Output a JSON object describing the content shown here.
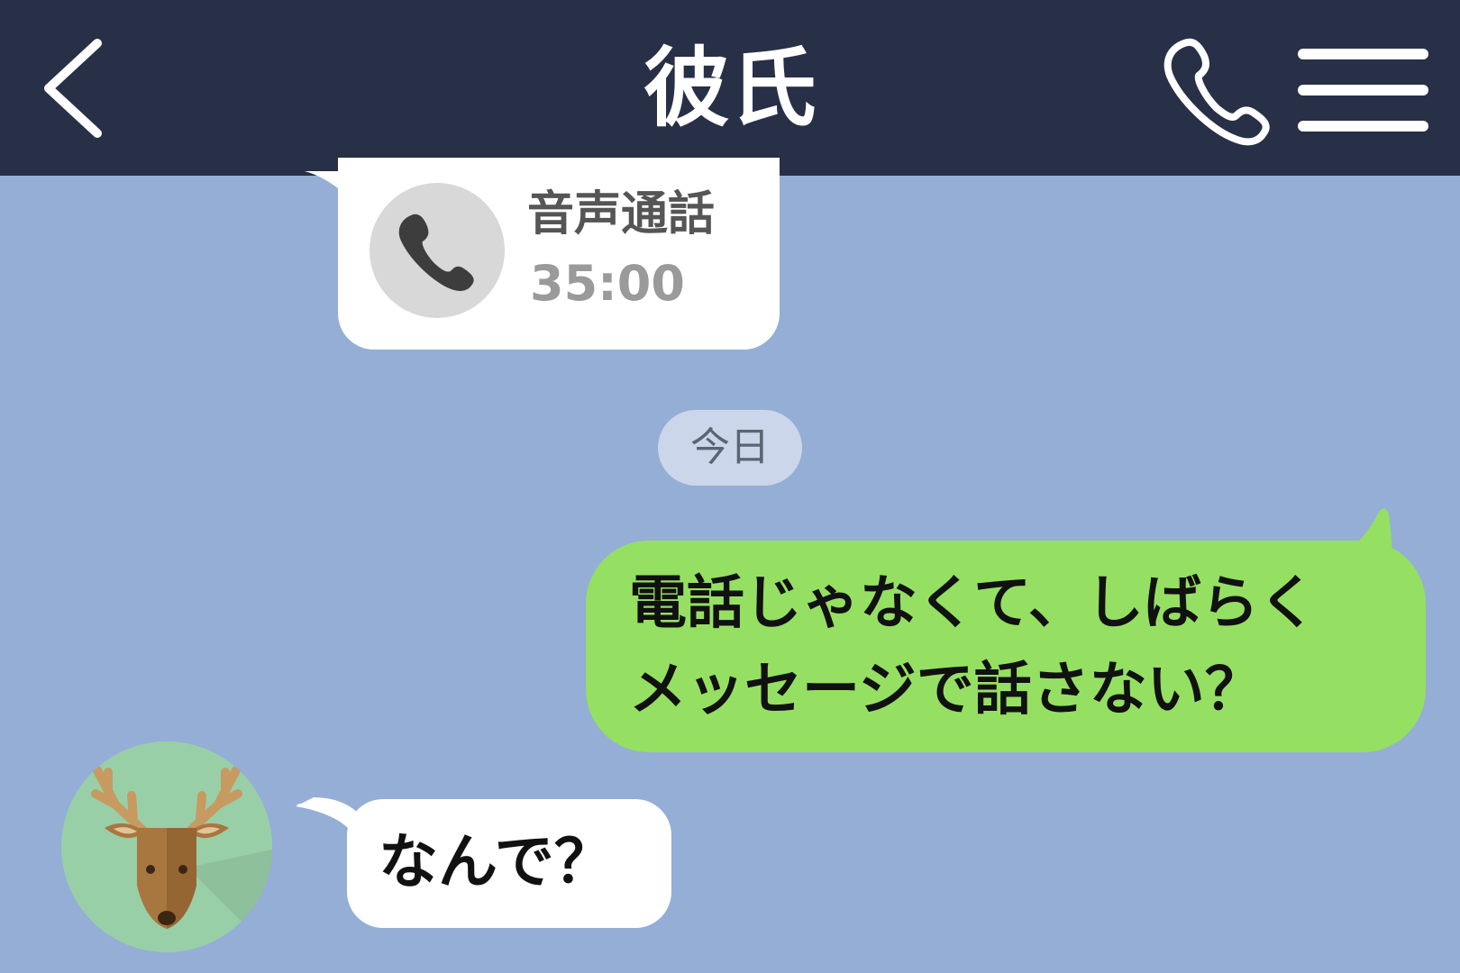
{
  "header": {
    "title": "彼氏",
    "background": "#283047"
  },
  "call_log": {
    "label": "音声通話",
    "duration": "35:00"
  },
  "date_separator": {
    "label": "今日"
  },
  "messages": [
    {
      "side": "right",
      "text": "電話じゃなくて、しばらく\nメッセージで話さない？",
      "color": "#95e062"
    },
    {
      "side": "left",
      "text": "なんで？",
      "color": "#ffffff"
    }
  ],
  "colors": {
    "chat_background": "#94aed6",
    "outgoing_bubble": "#95e062",
    "incoming_bubble": "#ffffff",
    "avatar_background": "#99cfa7"
  },
  "icons": {
    "back": "chevron-left-icon",
    "call": "phone-icon",
    "menu": "hamburger-menu-icon",
    "avatar": "deer-icon"
  }
}
